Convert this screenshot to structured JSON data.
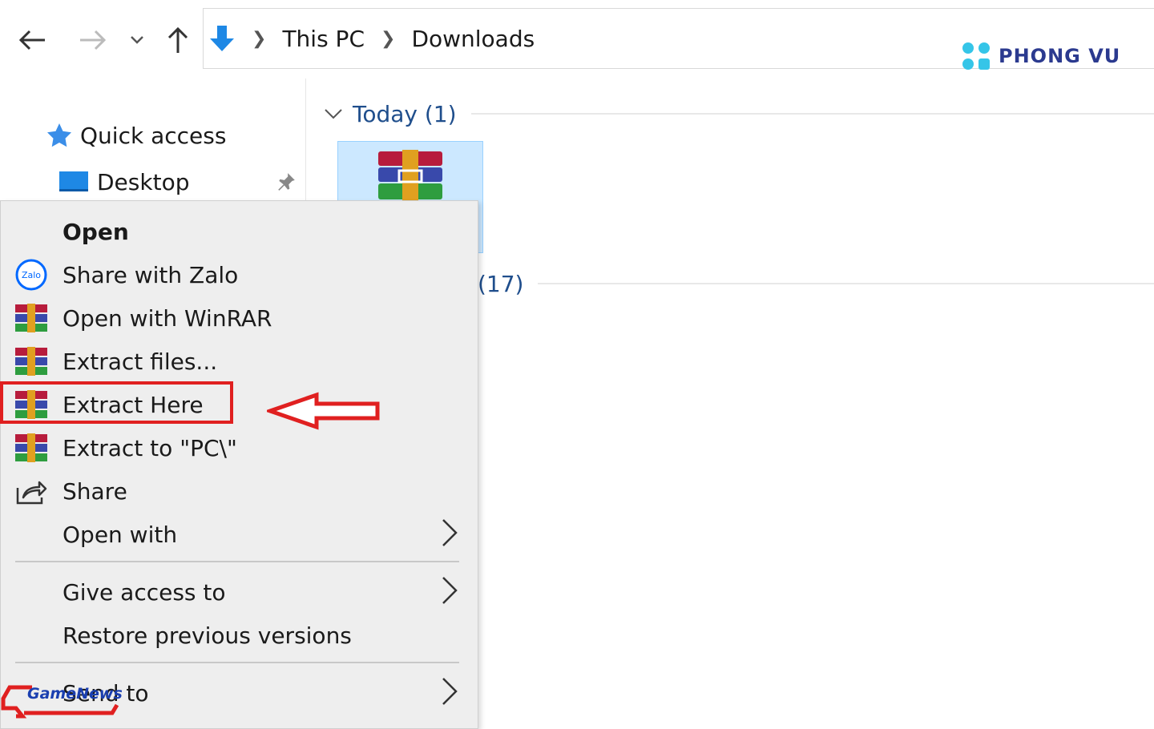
{
  "address": {
    "crumbs": [
      "This PC",
      "Downloads"
    ]
  },
  "logo": {
    "text": "PHONG VU"
  },
  "nav_pane": {
    "quick_access": "Quick access",
    "desktop": "Desktop"
  },
  "groups": {
    "today": "Today (1)",
    "earlier_count": "(17)"
  },
  "menu": {
    "open": "Open",
    "share_zalo": "Share with Zalo",
    "zalo_icon_text": "Zalo",
    "open_winrar": "Open with WinRAR",
    "extract_files": "Extract files...",
    "extract_here": "Extract Here",
    "extract_to": "Extract to \"PC\\\"",
    "share": "Share",
    "open_with": "Open with",
    "give_access": "Give access to",
    "restore": "Restore previous versions",
    "send_to": "Send to"
  },
  "watermark": {
    "text": "GameNews"
  },
  "colors": {
    "highlight": "#e02020",
    "accent": "#1f4e8c",
    "selection": "#cce8ff"
  }
}
